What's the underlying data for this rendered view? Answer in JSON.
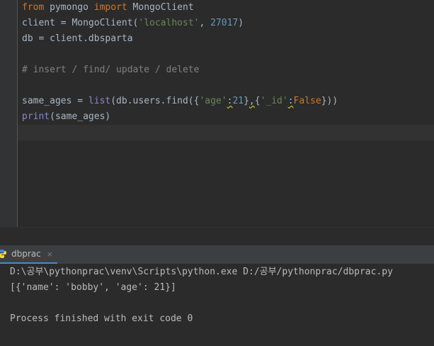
{
  "editor": {
    "lines": [
      {
        "tokens": [
          [
            "kw",
            "from"
          ],
          [
            "p",
            " pymongo "
          ],
          [
            "kw",
            "import"
          ],
          [
            "p",
            " MongoClient"
          ]
        ]
      },
      {
        "tokens": [
          [
            "p",
            "client = MongoClient("
          ],
          [
            "str",
            "'localhost'"
          ],
          [
            "p",
            ", "
          ],
          [
            "num",
            "27017"
          ],
          [
            "p",
            ")"
          ]
        ]
      },
      {
        "tokens": [
          [
            "p",
            "db = client.dbsparta"
          ]
        ]
      },
      {
        "tokens": []
      },
      {
        "tokens": [
          [
            "com",
            "# insert / find/ update / delete"
          ]
        ]
      },
      {
        "tokens": []
      },
      {
        "tokens": [
          [
            "p",
            "same_ages = "
          ],
          [
            "builtin",
            "list"
          ],
          [
            "p",
            "(db.users.find({"
          ],
          [
            "str",
            "'age'"
          ],
          [
            "warn",
            ":"
          ],
          [
            "num",
            "21"
          ],
          [
            "p",
            "}"
          ],
          [
            "warn",
            ","
          ],
          [
            "p",
            "{"
          ],
          [
            "str",
            "'_id'"
          ],
          [
            "warn",
            ":"
          ],
          [
            "kw",
            "False"
          ],
          [
            "p",
            "}))"
          ]
        ]
      },
      {
        "tokens": [
          [
            "builtin",
            "print"
          ],
          [
            "p",
            "(same_ages)"
          ]
        ]
      },
      {
        "tokens": [],
        "current": true
      }
    ]
  },
  "run_panel": {
    "tab_label": "dbprac",
    "close_glyph": "×"
  },
  "console": {
    "lines": [
      "D:\\공부\\pythonprac\\venv\\Scripts\\python.exe D:/공부/pythonprac/dbprac.py",
      "[{'name': 'bobby', 'age': 21}]",
      "",
      "Process finished with exit code 0"
    ]
  },
  "colors": {
    "background": "#2b2b2b",
    "keyword": "#cc7832",
    "string": "#6a8759",
    "number": "#6897bb",
    "comment": "#808080",
    "builtin": "#8888c6"
  }
}
